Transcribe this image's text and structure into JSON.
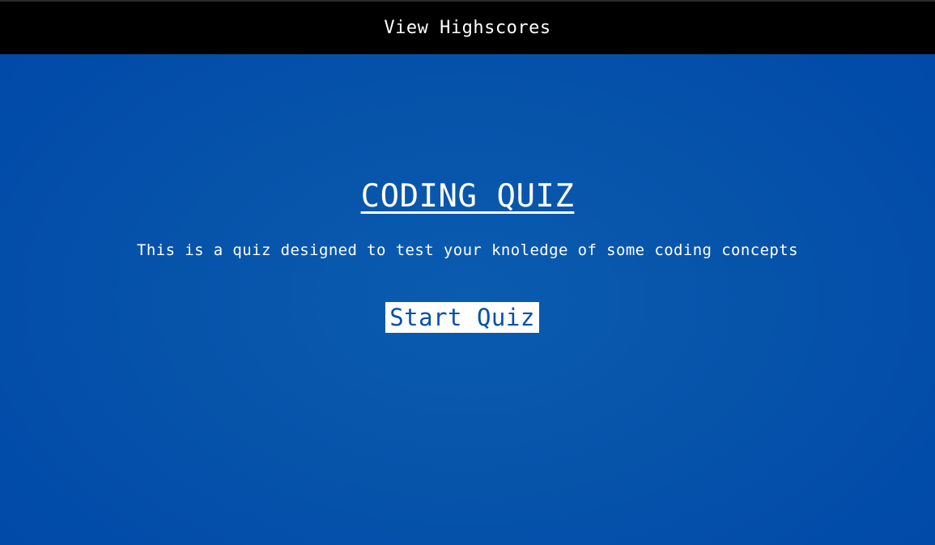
{
  "header": {
    "highscores_label": "View Highscores"
  },
  "main": {
    "title": "CODING QUIZ",
    "description": "This is a quiz designed to test your knoledge of some coding concepts",
    "start_button_label": "Start Quiz"
  },
  "colors": {
    "background": "#0653aa",
    "header_background": "#000000",
    "text": "#ffffff",
    "button_background": "#ffffff",
    "button_text": "#0650a8"
  }
}
